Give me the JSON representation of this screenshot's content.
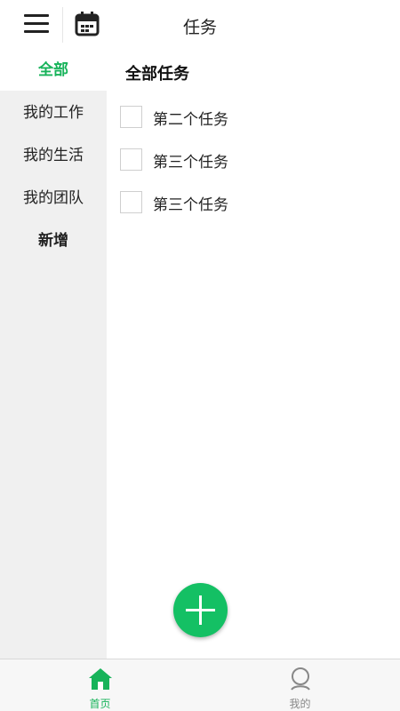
{
  "header": {
    "title": "任务",
    "menu_icon": "hamburger-menu-icon",
    "calendar_icon": "calendar-icon"
  },
  "sidebar": {
    "items": [
      {
        "label": "全部",
        "active": true
      },
      {
        "label": "我的工作",
        "active": false
      },
      {
        "label": "我的生活",
        "active": false
      },
      {
        "label": "我的团队",
        "active": false
      },
      {
        "label": "新增",
        "active": false
      }
    ]
  },
  "main": {
    "section_title": "全部任务",
    "tasks": [
      {
        "label": "第二个任务",
        "checked": false
      },
      {
        "label": "第三个任务",
        "checked": false
      },
      {
        "label": "第三个任务",
        "checked": false
      }
    ],
    "fab_icon": "plus-icon"
  },
  "tabbar": {
    "tabs": [
      {
        "label": "首页",
        "icon": "home-icon",
        "active": true
      },
      {
        "label": "我的",
        "icon": "user-icon",
        "active": false
      }
    ]
  },
  "colors": {
    "accent": "#17b35a",
    "fab": "#14c064",
    "sidebar_bg": "#f0f0f0",
    "tabbar_bg": "#f7f7f7"
  }
}
